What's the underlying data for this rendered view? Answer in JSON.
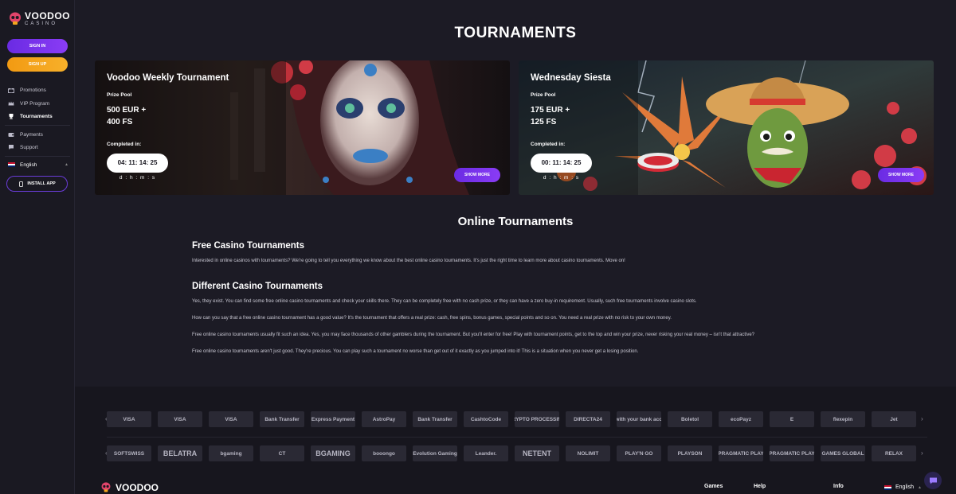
{
  "sidebar": {
    "logo_main": "VOODOO",
    "logo_sub": "CASINO",
    "signin_label": "SIGN IN",
    "signup_label": "SIGN UP",
    "nav": [
      {
        "label": "Promotions",
        "icon": "gift-icon"
      },
      {
        "label": "VIP Program",
        "icon": "crown-icon"
      },
      {
        "label": "Tournaments",
        "icon": "trophy-icon",
        "active": true
      },
      {
        "label": "Payments",
        "icon": "wallet-icon"
      },
      {
        "label": "Support",
        "icon": "chat-icon"
      }
    ],
    "language": "English",
    "install_label": "INSTALL APP"
  },
  "page": {
    "title": "TOURNAMENTS"
  },
  "tournaments": [
    {
      "title": "Voodoo Weekly Tournament",
      "prize_label": "Prize Pool",
      "prize_line1": "500 EUR +",
      "prize_line2": "400 FS",
      "completed_label": "Completed in:",
      "timer": "04: 11: 14: 25",
      "units": "d : h : m : s",
      "button": "SHOW MORE"
    },
    {
      "title": "Wednesday Siesta",
      "prize_label": "Prize Pool",
      "prize_line1": "175 EUR +",
      "prize_line2": "125 FS",
      "completed_label": "Completed in:",
      "timer": "00: 11: 14: 25",
      "units": "d : h : m : s",
      "button": "SHOW MORE"
    }
  ],
  "content": {
    "section_title": "Online Tournaments",
    "h1": "Free Casino Tournaments",
    "p1": "Interested in online casinos with tournaments? We're going to tell you everything we know about the best online casino tournaments. It's just the right time to learn more about casino tournaments. Move on!",
    "h2": "Different Casino Tournaments",
    "p2": "Yes, they exist. You can find some free online casino tournaments and check your skills there. They can be completely free with no cash prize, or they can have a zero buy-in requirement. Usually, such free tournaments involve casino slots.",
    "p3": "How can you say that a free online casino tournament has a good value? It's the tournament that offers a real prize: cash, free spins, bonus games, special points and so on. You need a real prize with no risk to your own money.",
    "p4": "Free online casino tournaments usually fit such an idea. Yes, you may face thousands of other gamblers during the tournament. But you'll enter for free! Play with tournament points, get to the top and win your prize, never risking your real money – isn't that attractive?",
    "p5": "Free online casino tournaments aren't just good. They're precious. You can play such a tournament no worse than get out of it exactly as you jumped into it! This is a situation when you never get a losing position."
  },
  "footer": {
    "payments": [
      "VISA",
      "VISA",
      "VISA",
      "Bank Transfer",
      "Express Payment",
      "AstroPay",
      "Bank Transfer",
      "CashtoCode",
      "CRYPTO PROCESSING",
      "DIRECTA24",
      "Pay with your bank account",
      "Boletol",
      "ecoPayz",
      "E",
      "flexepin",
      "Jet"
    ],
    "providers": [
      "SOFTSWISS",
      "BELATRA",
      "bgaming",
      "CT",
      "BGAMING",
      "booongo",
      "Evolution Gaming",
      "Leander.",
      "NETENT",
      "NOLIMIT",
      "PLAY'N GO",
      "PLAYSON",
      "PRAGMATIC PLAY",
      "PRAGMATIC PLAY",
      "GAMES GLOBAL",
      "RELAX"
    ],
    "logo": "VOODOO",
    "col_games": "Games",
    "col_help": "Help",
    "col_info": "Info",
    "language": "English"
  },
  "colors": {
    "accent_purple": "#7a34ee",
    "accent_orange": "#f5a51e",
    "background": "#1c1b25"
  }
}
